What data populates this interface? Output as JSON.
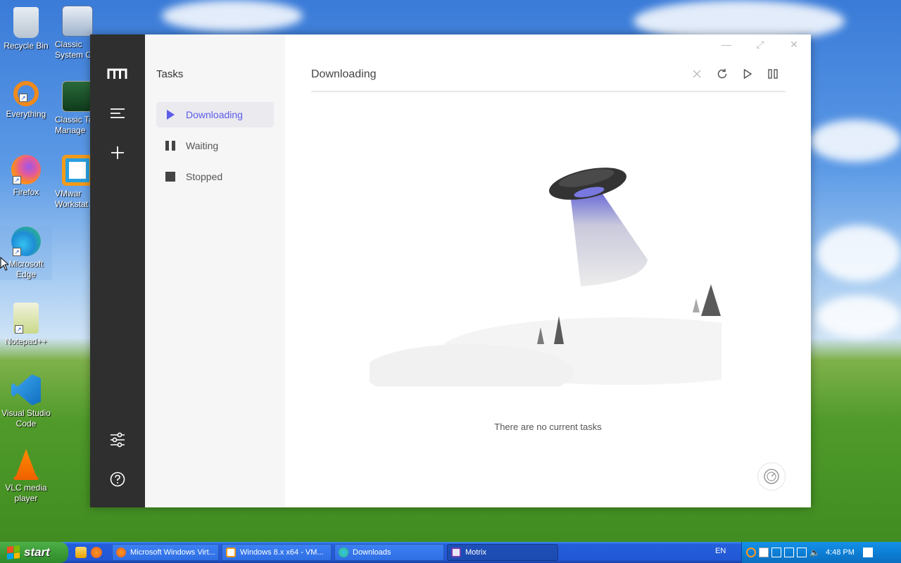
{
  "desktop": {
    "icons_col1": [
      {
        "label": "Recycle Bin",
        "icon": "recycle-bin-icon"
      },
      {
        "label": "Everything",
        "icon": "everything-search-icon"
      },
      {
        "label": "Firefox",
        "icon": "firefox-icon"
      },
      {
        "label": "Microsoft Edge",
        "icon": "edge-icon"
      },
      {
        "label": "Notepad++",
        "icon": "notepadpp-icon"
      },
      {
        "label": "Visual Studio Code",
        "icon": "vscode-icon"
      },
      {
        "label": "VLC media player",
        "icon": "vlc-icon"
      }
    ],
    "icons_col2": [
      {
        "label": "Classic System C",
        "icon": "control-panel-icon"
      },
      {
        "label": "Classic Ta Manage",
        "icon": "task-manager-icon"
      },
      {
        "label": "VMwar Workstat",
        "icon": "vmware-icon"
      }
    ]
  },
  "app": {
    "window_controls": {
      "minimize": "—",
      "maximize": "⤢",
      "close": "✕"
    },
    "rail": {
      "logo": "m"
    },
    "subnav": {
      "title": "Tasks",
      "items": [
        {
          "label": "Downloading",
          "icon": "play-icon",
          "active": true
        },
        {
          "label": "Waiting",
          "icon": "pause-icon",
          "active": false
        },
        {
          "label": "Stopped",
          "icon": "stop-icon",
          "active": false
        }
      ]
    },
    "main": {
      "title": "Downloading",
      "empty_text": "There are no current tasks"
    },
    "colors": {
      "accent": "#5b5bea",
      "rail": "#2f2f2f"
    }
  },
  "taskbar": {
    "start_label": "start",
    "buttons": [
      {
        "label": "Microsoft Windows Virt...",
        "icon": "firefox-icon"
      },
      {
        "label": "Windows 8.x x64 - VM...",
        "icon": "vmware-icon"
      },
      {
        "label": "Downloads",
        "icon": "edge-icon"
      },
      {
        "label": "Motrix",
        "icon": "motrix-icon",
        "active": true
      }
    ],
    "language": "EN",
    "clock": "4:48 PM"
  }
}
